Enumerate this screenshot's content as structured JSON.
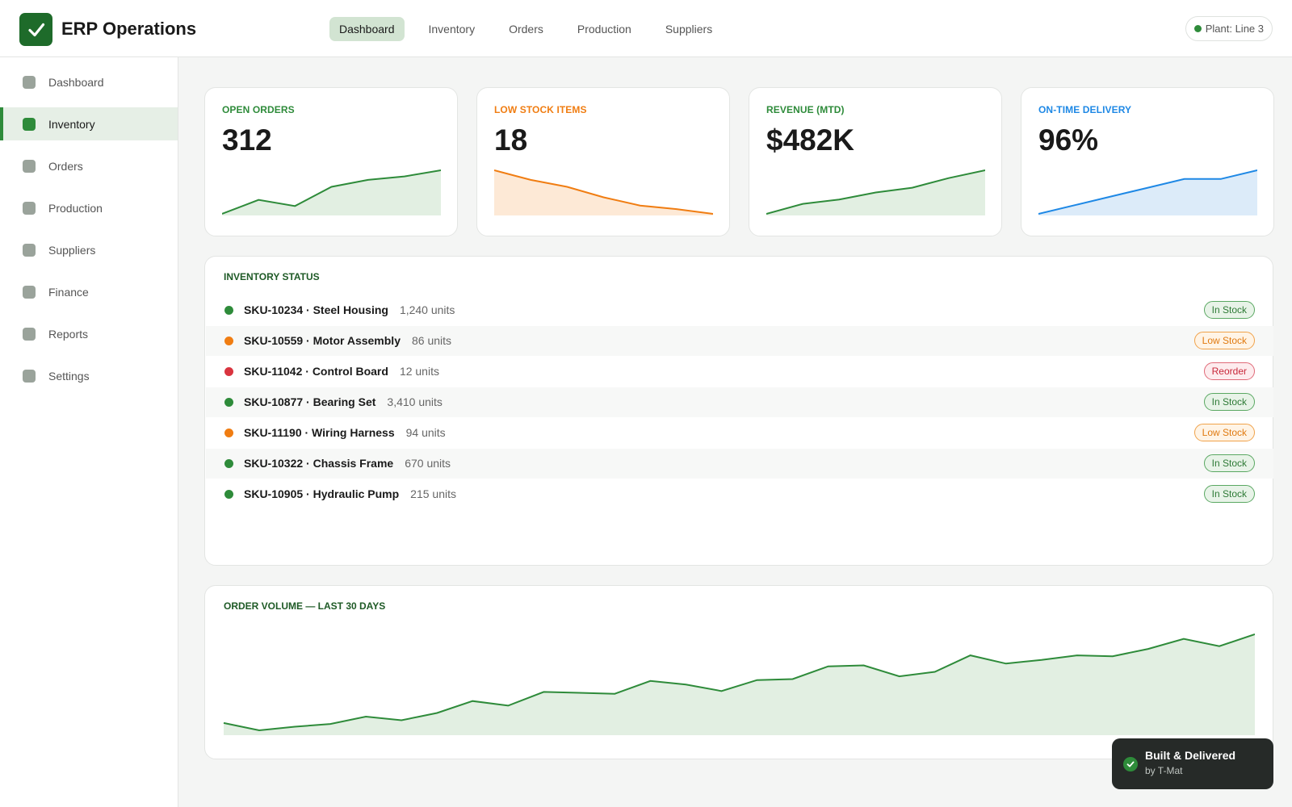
{
  "header": {
    "app_title": "ERP Operations",
    "logo_icon": "checkmark-icon",
    "nav": [
      {
        "label": "Dashboard",
        "active": true
      },
      {
        "label": "Inventory",
        "active": false
      },
      {
        "label": "Orders",
        "active": false
      },
      {
        "label": "Production",
        "active": false
      },
      {
        "label": "Suppliers",
        "active": false
      }
    ],
    "plant_label": "Plant: Line 3"
  },
  "sidebar": {
    "items": [
      {
        "label": "Dashboard",
        "active": false
      },
      {
        "label": "Inventory",
        "active": true
      },
      {
        "label": "Orders",
        "active": false
      },
      {
        "label": "Production",
        "active": false
      },
      {
        "label": "Suppliers",
        "active": false
      },
      {
        "label": "Finance",
        "active": false
      },
      {
        "label": "Reports",
        "active": false
      },
      {
        "label": "Settings",
        "active": false
      }
    ]
  },
  "kpis": [
    {
      "label": "OPEN ORDERS",
      "value": "312",
      "color": "#2e8b3a",
      "fill": "#e2efe2",
      "trend": [
        0,
        3.2,
        1.8,
        6.2,
        7.8,
        8.6,
        10
      ]
    },
    {
      "label": "LOW STOCK ITEMS",
      "value": "18",
      "color": "#f07d12",
      "fill": "#fde9d6",
      "trend": [
        10,
        7.8,
        6.2,
        3.8,
        1.9,
        1.1,
        0
      ]
    },
    {
      "label": "REVENUE (MTD)",
      "value": "$482K",
      "color": "#2e8b3a",
      "fill": "#e2efe2",
      "trend": [
        0,
        2.3,
        3.3,
        4.9,
        6.0,
        8.2,
        10
      ]
    },
    {
      "label": "ON-TIME DELIVERY",
      "value": "96%",
      "color": "#1e88e5",
      "fill": "#dcebf9",
      "trend": [
        0,
        2,
        4,
        6,
        8,
        8,
        10
      ]
    }
  ],
  "inventory": {
    "title": "INVENTORY STATUS",
    "rows": [
      {
        "sku": "SKU-10234 · Steel Housing",
        "units": "1,240 units",
        "status": "In Stock",
        "kind": "in",
        "dot": "#2e8b3a"
      },
      {
        "sku": "SKU-10559 · Motor Assembly",
        "units": "86 units",
        "status": "Low Stock",
        "kind": "low",
        "dot": "#f07d12"
      },
      {
        "sku": "SKU-11042 · Control Board",
        "units": "12 units",
        "status": "Reorder",
        "kind": "re",
        "dot": "#d9343f"
      },
      {
        "sku": "SKU-10877 · Bearing Set",
        "units": "3,410 units",
        "status": "In Stock",
        "kind": "in",
        "dot": "#2e8b3a"
      },
      {
        "sku": "SKU-11190 · Wiring Harness",
        "units": "94 units",
        "status": "Low Stock",
        "kind": "low",
        "dot": "#f07d12"
      },
      {
        "sku": "SKU-10322 · Chassis Frame",
        "units": "670 units",
        "status": "In Stock",
        "kind": "in",
        "dot": "#2e8b3a"
      },
      {
        "sku": "SKU-10905 · Hydraulic Pump",
        "units": "215 units",
        "status": "In Stock",
        "kind": "in",
        "dot": "#2e8b3a"
      }
    ]
  },
  "order_volume": {
    "title": "ORDER VOLUME — LAST 30 DAYS",
    "color": "#2e8b3a",
    "fill": "#e2efe2",
    "values": [
      8,
      0,
      4,
      7,
      15,
      11,
      19,
      32,
      27,
      42,
      41,
      40,
      54,
      50,
      43,
      55,
      56,
      70,
      71,
      59,
      64,
      82,
      73,
      77,
      82,
      81,
      89,
      100,
      92,
      105
    ]
  },
  "toast": {
    "title": "Built & Delivered",
    "subtitle": "by T-Mat",
    "icon": "check-circle-icon"
  }
}
